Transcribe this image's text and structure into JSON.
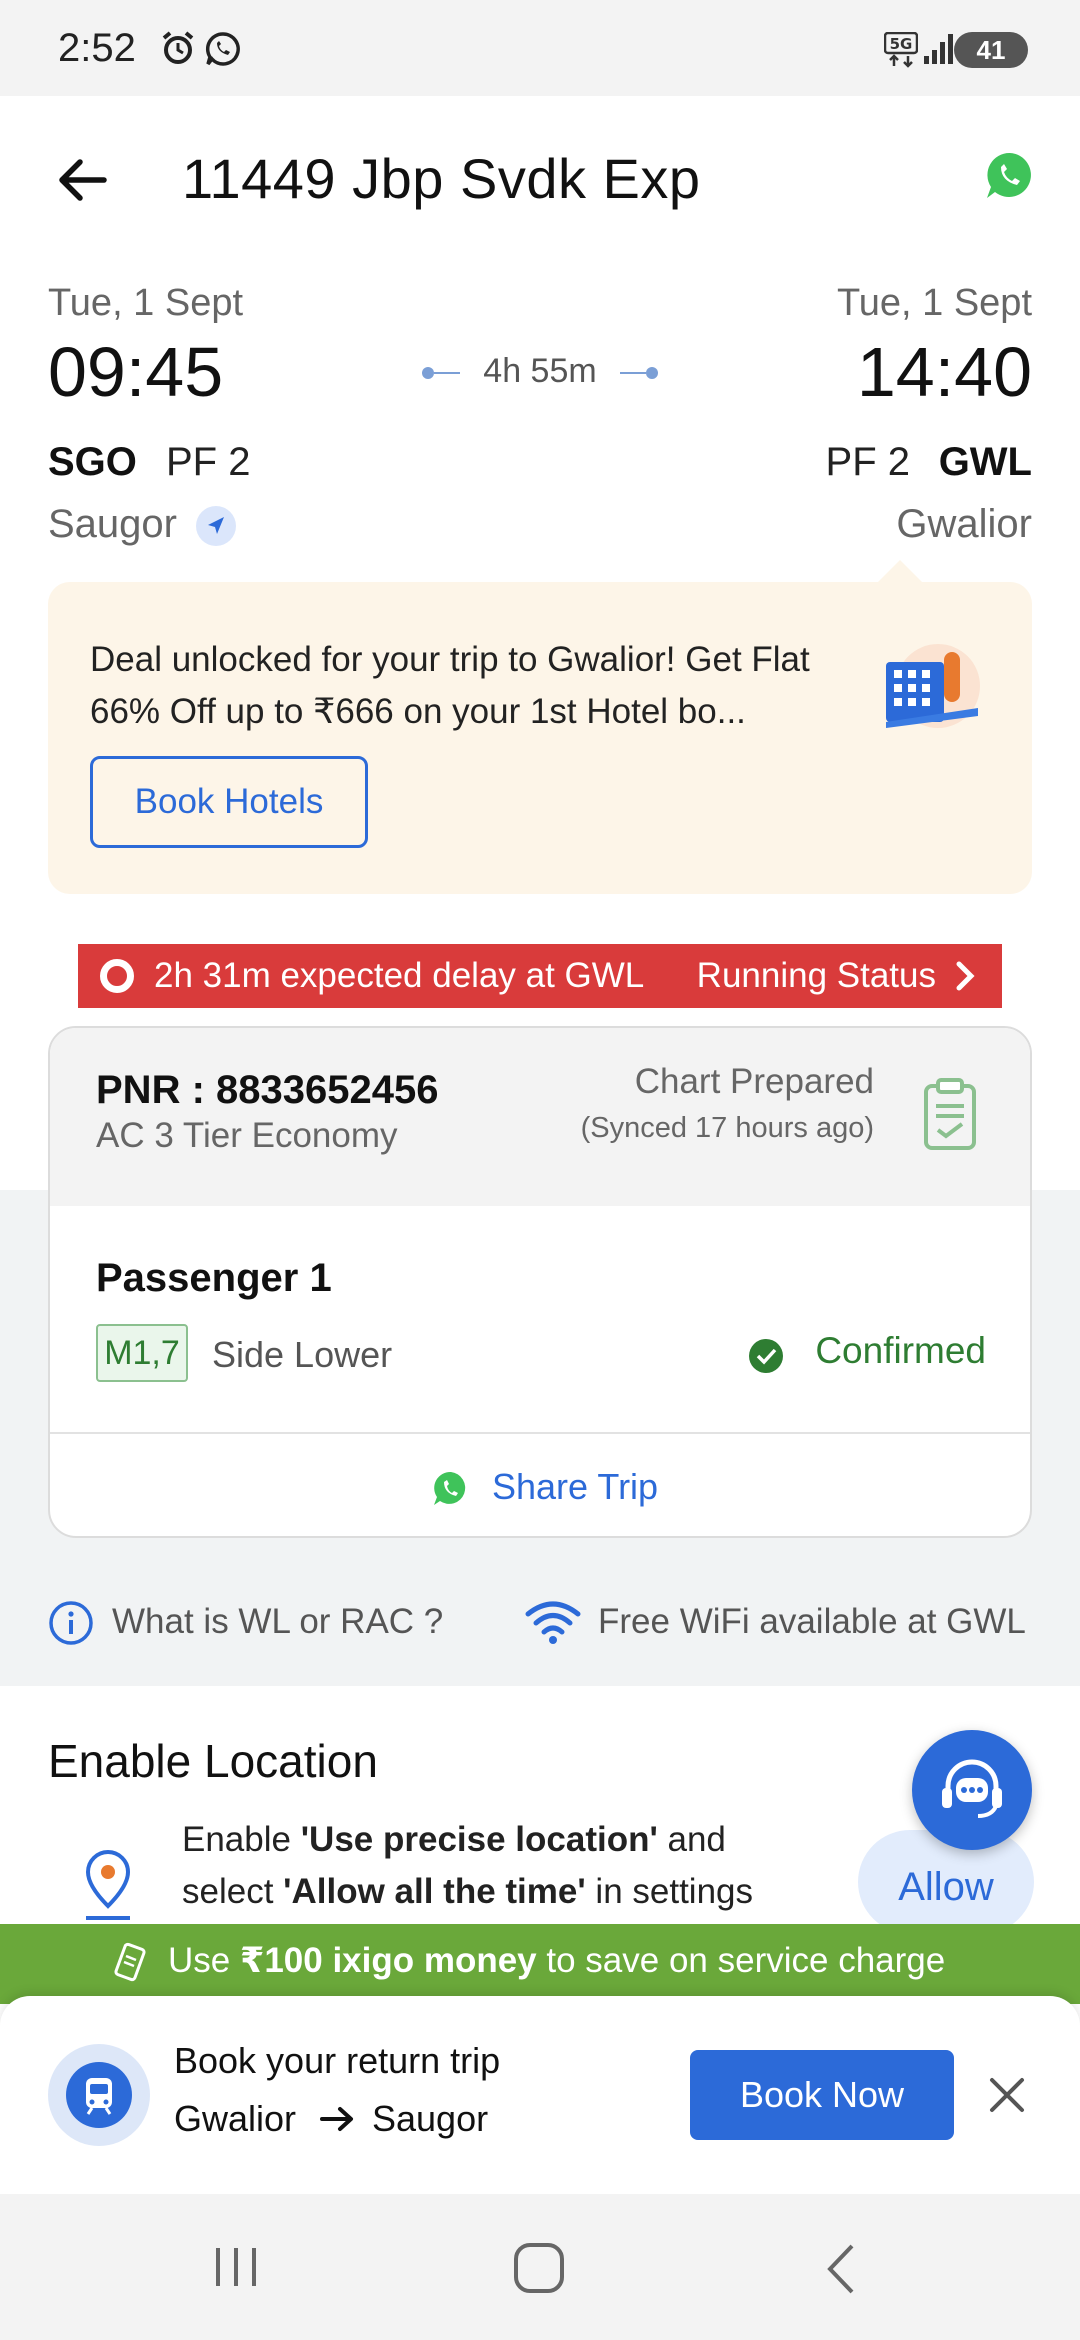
{
  "status_bar": {
    "time": "2:52",
    "battery": "41",
    "icons": [
      "alarm-icon",
      "whatsapp-icon",
      "5g-icon",
      "signal-icon",
      "battery-icon"
    ]
  },
  "header": {
    "title": "11449 Jbp Svdk Exp"
  },
  "journey": {
    "departure": {
      "date": "Tue, 1 Sept",
      "time": "09:45",
      "code": "SGO",
      "platform": "PF 2",
      "station": "Saugor"
    },
    "arrival": {
      "date": "Tue, 1 Sept",
      "time": "14:40",
      "code": "GWL",
      "platform": "PF 2",
      "station": "Gwalior"
    },
    "duration": "4h 55m"
  },
  "deal": {
    "text": "Deal unlocked for your trip to Gwalior! Get Flat 66% Off up to ₹666 on your 1st Hotel bo...",
    "button": "Book Hotels"
  },
  "delay": {
    "text": "2h 31m expected delay at GWL",
    "link": "Running Status"
  },
  "pnr": {
    "number": "PNR : 8833652456",
    "class": "AC 3 Tier Economy",
    "chart_status": "Chart Prepared",
    "synced": "(Synced 17 hours ago)",
    "passenger": {
      "name": "Passenger 1",
      "berth": "M1,7",
      "berth_type": "Side Lower",
      "status": "Confirmed"
    },
    "share": "Share Trip"
  },
  "info": {
    "wl_rac": "What is WL or RAC ?",
    "wifi": "Free WiFi available at GWL"
  },
  "location": {
    "title": "Enable Location",
    "text_1": "Enable ",
    "text_bold_1": "'Use precise location'",
    "text_2": " and select ",
    "text_bold_2": "'Allow all the time'",
    "text_3": " in settings",
    "button": "Allow"
  },
  "money_banner": {
    "prefix": "Use ",
    "bold": "₹100 ixigo money",
    "suffix": " to save on service charge"
  },
  "return_trip": {
    "title": "Book your return trip",
    "from": "Gwalior",
    "to": "Saugor",
    "button": "Book Now"
  },
  "colors": {
    "accent": "#2c6ad8",
    "delay": "#d93b3b",
    "confirmed": "#2e7d32",
    "banner": "#6aa83a",
    "deal_bg": "#fdf5e8"
  }
}
